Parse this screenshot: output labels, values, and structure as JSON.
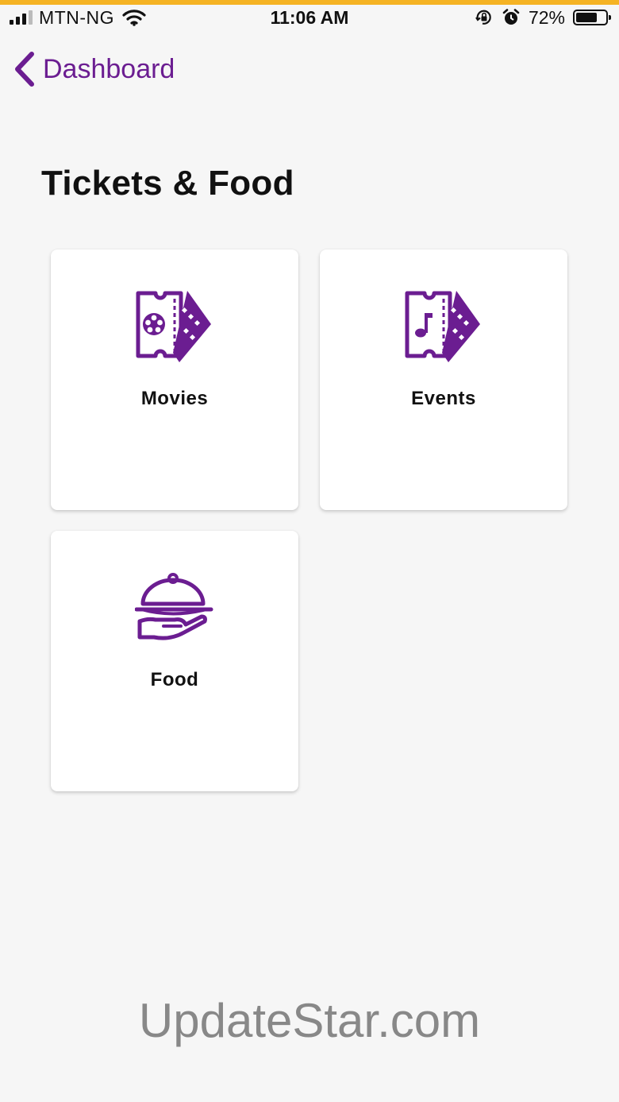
{
  "status_bar": {
    "carrier": "MTN-NG",
    "time": "11:06 AM",
    "battery_percent": "72%",
    "battery_level": 0.72,
    "icons": [
      "signal-icon",
      "wifi-icon",
      "orientation-lock-icon",
      "alarm-icon",
      "battery-icon"
    ]
  },
  "nav": {
    "back_label": "Dashboard",
    "back_icon": "chevron-left-icon"
  },
  "page": {
    "title": "Tickets & Food"
  },
  "cards": [
    {
      "label": "Movies",
      "icon": "movie-ticket-icon"
    },
    {
      "label": "Events",
      "icon": "event-ticket-icon"
    },
    {
      "label": "Food",
      "icon": "food-cloche-icon"
    }
  ],
  "watermark": "UpdateStar.com",
  "colors": {
    "accent": "#6b1d91",
    "background": "#f6f6f6",
    "card": "#ffffff",
    "top_strip": "#f5b324"
  }
}
